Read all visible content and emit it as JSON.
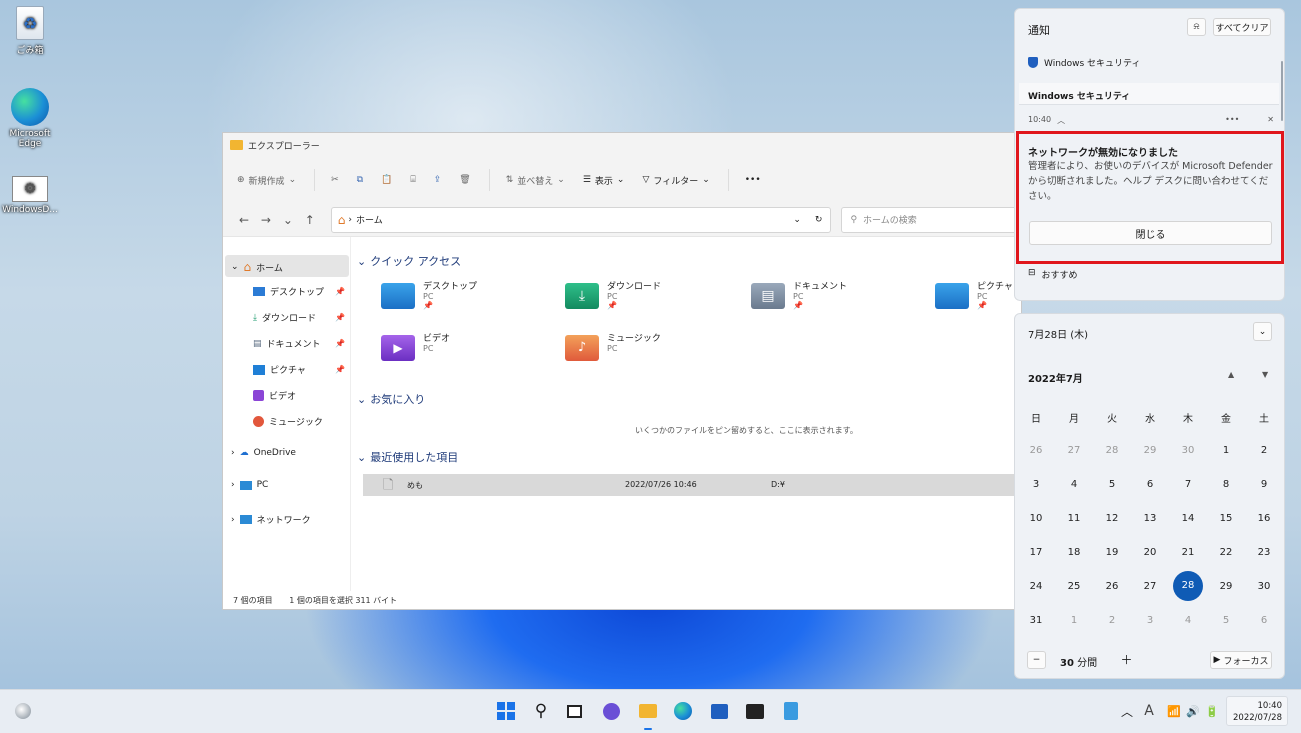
{
  "desktop": {
    "icons": [
      {
        "label": "ごみ箱"
      },
      {
        "label": "Microsoft Edge"
      },
      {
        "label": "WindowsD..."
      }
    ]
  },
  "explorer": {
    "title": "エクスプローラー",
    "commands": {
      "new": "新規作成",
      "sort": "並べ替え",
      "view": "表示",
      "filter": "フィルター",
      "more": "•••"
    },
    "address": "ホーム",
    "search_placeholder": "ホームの検索",
    "sidebar": [
      {
        "label": "ホーム"
      },
      {
        "label": "デスクトップ"
      },
      {
        "label": "ダウンロード"
      },
      {
        "label": "ドキュメント"
      },
      {
        "label": "ピクチャ"
      },
      {
        "label": "ビデオ"
      },
      {
        "label": "ミュージック"
      },
      {
        "label": "OneDrive"
      },
      {
        "label": "PC"
      },
      {
        "label": "ネットワーク"
      }
    ],
    "quick_access": {
      "heading": "クイック アクセス",
      "items": [
        {
          "name": "デスクトップ",
          "loc": "PC"
        },
        {
          "name": "ダウンロード",
          "loc": "PC"
        },
        {
          "name": "ドキュメント",
          "loc": "PC"
        },
        {
          "name": "ピクチャ",
          "loc": "PC"
        },
        {
          "name": "ビデオ",
          "loc": "PC"
        },
        {
          "name": "ミュージック",
          "loc": "PC"
        }
      ]
    },
    "favorites": {
      "heading": "お気に入り",
      "empty": "いくつかのファイルをピン留めすると、ここに表示されます。"
    },
    "recent": {
      "heading": "最近使用した項目",
      "rows": [
        {
          "name": "めも",
          "date": "2022/07/26 10:46",
          "loc": "D:¥"
        }
      ]
    },
    "status": {
      "count": "7 個の項目",
      "selected": "1 個の項目を選択 311 バイト"
    }
  },
  "notifications": {
    "title": "通知",
    "clear_all": "すべてクリア",
    "app": "Windows セキュリティ",
    "group": "Windows セキュリティ",
    "time": "10:40",
    "more": "•••",
    "alert_title": "ネットワークが無効になりました",
    "alert_body": "管理者により、お使いのデバイスが Microsoft Defender から切断されました。ヘルプ デスクに問い合わせてください。",
    "close_button": "閉じる",
    "recommended": "おすすめ"
  },
  "calendar": {
    "date_header": "7月28日 (木)",
    "month": "2022年7月",
    "weekdays": [
      "日",
      "月",
      "火",
      "水",
      "木",
      "金",
      "土"
    ],
    "weeks": [
      [
        "26",
        "27",
        "28",
        "29",
        "30",
        "1",
        "2"
      ],
      [
        "3",
        "4",
        "5",
        "6",
        "7",
        "8",
        "9"
      ],
      [
        "10",
        "11",
        "12",
        "13",
        "14",
        "15",
        "16"
      ],
      [
        "17",
        "18",
        "19",
        "20",
        "21",
        "22",
        "23"
      ],
      [
        "24",
        "25",
        "26",
        "27",
        "28",
        "29",
        "30"
      ],
      [
        "31",
        "1",
        "2",
        "3",
        "4",
        "5",
        "6"
      ]
    ],
    "today": "28",
    "focus_minutes": "30",
    "focus_unit": "分間",
    "focus_button": "フォーカス"
  },
  "taskbar": {
    "time": "10:40",
    "date": "2022/07/28",
    "ime": "A"
  },
  "colors": {
    "accent": "#0f5bb5",
    "alert_border": "#e0161c"
  }
}
